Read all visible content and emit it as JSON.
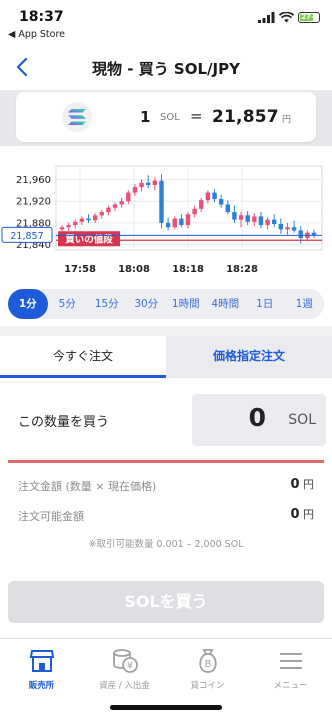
{
  "status_bar": {
    "time": "18:37",
    "back_label": "◀ App Store",
    "battery": "27+"
  },
  "header": {
    "title": "現物 - 買う SOL/JPY"
  },
  "price_card": {
    "quantity": "1",
    "unit": "SOL",
    "equals": "=",
    "price": "21,857",
    "currency": "円",
    "coin_icon": "solana-logo-icon"
  },
  "chart": {
    "y_ticks": [
      "21,960",
      "21,920",
      "21,880",
      "21,840"
    ],
    "x_ticks": [
      "17:58",
      "18:08",
      "18:18",
      "18:28"
    ],
    "current_price_label": "21,857",
    "buy_price_label": "買いの値段"
  },
  "chart_data": {
    "type": "candlestick",
    "xlabel": "",
    "ylabel": "",
    "ylim": [
      21830,
      21985
    ],
    "x_ticks": [
      "17:58",
      "18:08",
      "18:18",
      "18:28"
    ],
    "current_price": 21857,
    "buy_price": 21848,
    "candles": [
      {
        "o": 21868,
        "h": 21876,
        "l": 21860,
        "c": 21872
      },
      {
        "o": 21872,
        "h": 21880,
        "l": 21866,
        "c": 21876
      },
      {
        "o": 21876,
        "h": 21886,
        "l": 21870,
        "c": 21882
      },
      {
        "o": 21882,
        "h": 21892,
        "l": 21876,
        "c": 21888
      },
      {
        "o": 21888,
        "h": 21896,
        "l": 21880,
        "c": 21885
      },
      {
        "o": 21885,
        "h": 21898,
        "l": 21880,
        "c": 21894
      },
      {
        "o": 21894,
        "h": 21904,
        "l": 21888,
        "c": 21900
      },
      {
        "o": 21900,
        "h": 21912,
        "l": 21894,
        "c": 21908
      },
      {
        "o": 21908,
        "h": 21918,
        "l": 21902,
        "c": 21914
      },
      {
        "o": 21914,
        "h": 21926,
        "l": 21908,
        "c": 21920
      },
      {
        "o": 21920,
        "h": 21940,
        "l": 21915,
        "c": 21936
      },
      {
        "o": 21936,
        "h": 21952,
        "l": 21930,
        "c": 21946
      },
      {
        "o": 21946,
        "h": 21960,
        "l": 21938,
        "c": 21954
      },
      {
        "o": 21954,
        "h": 21968,
        "l": 21944,
        "c": 21950
      },
      {
        "o": 21950,
        "h": 21964,
        "l": 21940,
        "c": 21958
      },
      {
        "o": 21958,
        "h": 21970,
        "l": 21870,
        "c": 21880
      },
      {
        "o": 21880,
        "h": 21890,
        "l": 21866,
        "c": 21872
      },
      {
        "o": 21872,
        "h": 21892,
        "l": 21868,
        "c": 21888
      },
      {
        "o": 21888,
        "h": 21896,
        "l": 21872,
        "c": 21876
      },
      {
        "o": 21876,
        "h": 21900,
        "l": 21870,
        "c": 21896
      },
      {
        "o": 21896,
        "h": 21912,
        "l": 21890,
        "c": 21906
      },
      {
        "o": 21906,
        "h": 21926,
        "l": 21900,
        "c": 21922
      },
      {
        "o": 21922,
        "h": 21940,
        "l": 21916,
        "c": 21936
      },
      {
        "o": 21936,
        "h": 21942,
        "l": 21918,
        "c": 21924
      },
      {
        "o": 21924,
        "h": 21932,
        "l": 21908,
        "c": 21914
      },
      {
        "o": 21914,
        "h": 21922,
        "l": 21896,
        "c": 21900
      },
      {
        "o": 21900,
        "h": 21912,
        "l": 21880,
        "c": 21886
      },
      {
        "o": 21886,
        "h": 21900,
        "l": 21872,
        "c": 21894
      },
      {
        "o": 21894,
        "h": 21902,
        "l": 21876,
        "c": 21882
      },
      {
        "o": 21882,
        "h": 21898,
        "l": 21874,
        "c": 21892
      },
      {
        "o": 21892,
        "h": 21900,
        "l": 21870,
        "c": 21876
      },
      {
        "o": 21876,
        "h": 21890,
        "l": 21868,
        "c": 21886
      },
      {
        "o": 21886,
        "h": 21896,
        "l": 21872,
        "c": 21878
      },
      {
        "o": 21878,
        "h": 21888,
        "l": 21860,
        "c": 21868
      },
      {
        "o": 21868,
        "h": 21880,
        "l": 21858,
        "c": 21872
      },
      {
        "o": 21872,
        "h": 21884,
        "l": 21862,
        "c": 21866
      },
      {
        "o": 21866,
        "h": 21874,
        "l": 21842,
        "c": 21852
      },
      {
        "o": 21852,
        "h": 21866,
        "l": 21846,
        "c": 21862
      },
      {
        "o": 21862,
        "h": 21868,
        "l": 21852,
        "c": 21857
      }
    ],
    "colors": {
      "up": "#e8507a",
      "down": "#2f7fd8"
    }
  },
  "intervals": {
    "items": [
      "1分",
      "5分",
      "15分",
      "30分",
      "1時間",
      "4時間",
      "1日",
      "1週"
    ],
    "active_index": 0
  },
  "order_tabs": {
    "immediate": "今すぐ注文",
    "limit": "価格指定注文"
  },
  "form": {
    "quantity_label": "この数量を買う",
    "quantity_value": "0",
    "quantity_unit": "SOL",
    "order_amount_label": "注文金額 (数量 × 現在価格)",
    "order_amount_value": "0",
    "available_label": "注文可能金額",
    "available_value": "0",
    "yen": "円",
    "note": "※取引可能数量 0.001 – 2,000 SOL"
  },
  "buy_button": {
    "label": "SOLを買う"
  },
  "tabbar": {
    "items": [
      {
        "label": "販売所",
        "icon": "store-icon"
      },
      {
        "label": "資産 / 入出金",
        "icon": "coins-yen-icon"
      },
      {
        "label": "貸コイン",
        "icon": "bitcoin-bag-icon"
      },
      {
        "label": "メニュー",
        "icon": "hamburger-menu-icon"
      }
    ],
    "active_index": 0
  },
  "colors": {
    "accent": "#1e5bd8",
    "up_candle": "#e8507a",
    "down_candle": "#2f7fd8",
    "buy_price_line": "#d8344e"
  }
}
